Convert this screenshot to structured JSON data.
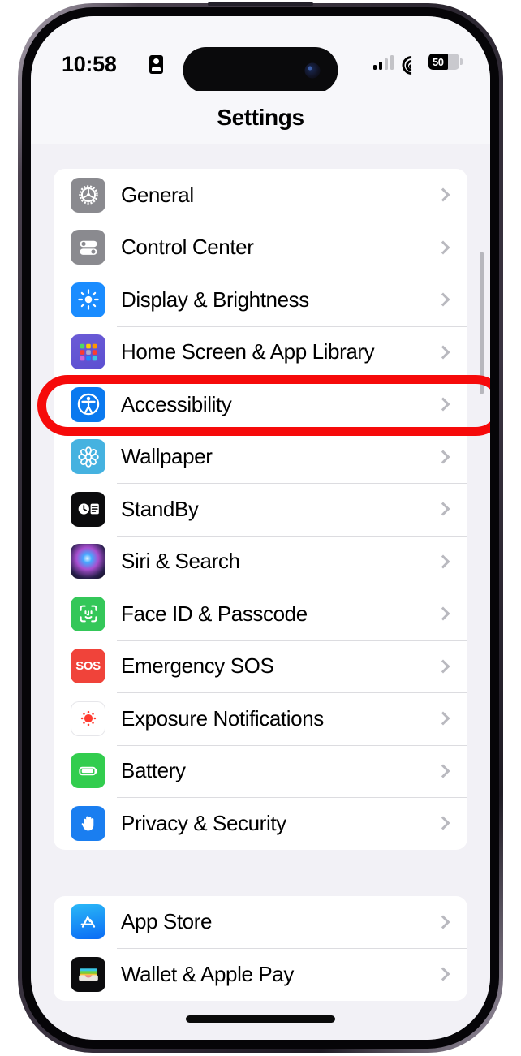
{
  "device": {
    "frame": "iphone-14-pro",
    "bezel_color": "#2b2630"
  },
  "status_bar": {
    "time": "10:58",
    "recording_icon": "id-card-icon",
    "signal_icon": "cellular-signal-icon",
    "signal_bars_active": 2,
    "signal_bars_total": 4,
    "wifi_icon": "wifi-icon",
    "battery_icon": "battery-icon",
    "battery_percent": "50",
    "battery_fill_ratio": 0.62
  },
  "nav": {
    "title": "Settings"
  },
  "annotation": {
    "type": "red-oval-highlight",
    "color": "#f60a0a",
    "targets_row": "Accessibility"
  },
  "groups": [
    {
      "id": "group-primary",
      "rows": [
        {
          "label": "General",
          "icon": "gear-icon",
          "icon_color": "#8a8a8f",
          "chevron": true
        },
        {
          "label": "Control Center",
          "icon": "toggles-icon",
          "icon_color": "#8a8a8f",
          "chevron": true
        },
        {
          "label": "Display & Brightness",
          "icon": "brightness-sun-icon",
          "icon_color": "#1a8cff",
          "chevron": true
        },
        {
          "label": "Home Screen & App Library",
          "icon": "app-grid-icon",
          "icon_color": "#5c4fd1",
          "chevron": true
        },
        {
          "label": "Accessibility",
          "icon": "accessibility-icon",
          "icon_color": "#0a79ef",
          "chevron": true,
          "highlighted": true
        },
        {
          "label": "Wallpaper",
          "icon": "flower-icon",
          "icon_color": "#45b2e0",
          "chevron": true
        },
        {
          "label": "StandBy",
          "icon": "standby-clock-icon",
          "icon_color": "#0b0b0d",
          "chevron": true
        },
        {
          "label": "Siri & Search",
          "icon": "siri-orb-icon",
          "icon_color": "#2a1f4e",
          "chevron": true
        },
        {
          "label": "Face ID & Passcode",
          "icon": "face-id-icon",
          "icon_color": "#34c759",
          "chevron": true
        },
        {
          "label": "Emergency SOS",
          "icon": "sos-icon",
          "icon_color": "#f0433a",
          "chevron": true
        },
        {
          "label": "Exposure Notifications",
          "icon": "exposure-dot-icon",
          "icon_color": "#ff3b30",
          "chevron": true
        },
        {
          "label": "Battery",
          "icon": "battery-icon",
          "icon_color": "#32cd4e",
          "chevron": true
        },
        {
          "label": "Privacy & Security",
          "icon": "hand-icon",
          "icon_color": "#1a7ef0",
          "chevron": true
        }
      ]
    },
    {
      "id": "group-secondary",
      "rows": [
        {
          "label": "App Store",
          "icon": "app-store-icon",
          "icon_color": "#0a6bf5",
          "chevron": true
        },
        {
          "label": "Wallet & Apple Pay",
          "icon": "wallet-icon",
          "icon_color": "#0c0c0e",
          "chevron": true
        }
      ]
    }
  ],
  "home_indicator": "home-indicator-bar"
}
